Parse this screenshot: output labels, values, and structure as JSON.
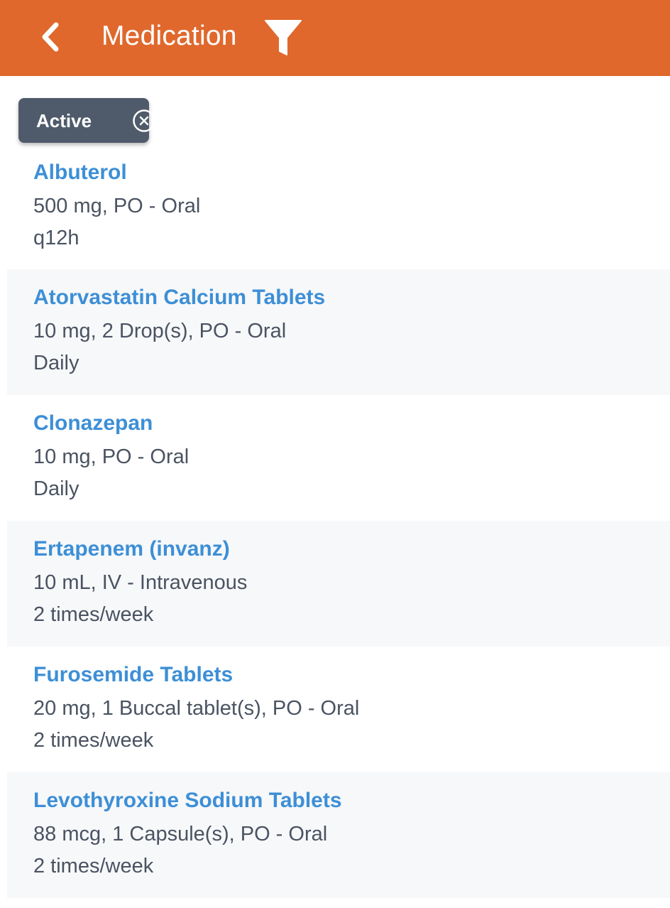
{
  "header": {
    "title": "Medication",
    "back_icon": "chevron-left-icon",
    "filter_icon": "filter-icon",
    "color": "#e0682c"
  },
  "filter_chip": {
    "label": "Active",
    "close_icon": "close-circle-icon"
  },
  "medications": [
    {
      "name": "Albuterol",
      "dose": "500 mg, PO - Oral",
      "frequency": "q12h"
    },
    {
      "name": "Atorvastatin Calcium Tablets",
      "dose": "10 mg, 2 Drop(s), PO - Oral",
      "frequency": "Daily"
    },
    {
      "name": "Clonazepan",
      "dose": "10 mg, PO - Oral",
      "frequency": "Daily"
    },
    {
      "name": "Ertapenem (invanz)",
      "dose": "10 mL, IV - Intravenous",
      "frequency": "2 times/week"
    },
    {
      "name": "Furosemide Tablets",
      "dose": "20 mg, 1 Buccal tablet(s), PO - Oral",
      "frequency": "2 times/week"
    },
    {
      "name": "Levothyroxine Sodium Tablets",
      "dose": "88 mcg, 1 Capsule(s), PO - Oral",
      "frequency": "2 times/week"
    }
  ],
  "colors": {
    "link": "#3d8fd6",
    "text": "#4a5361",
    "chip_bg": "#4f5b6b",
    "alt_row": "#f7f8fa"
  }
}
